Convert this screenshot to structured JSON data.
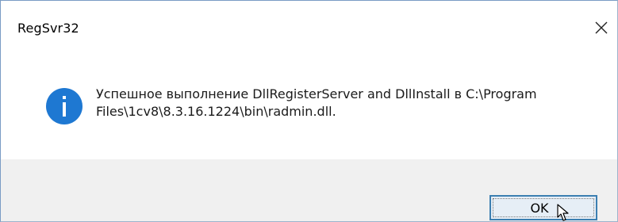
{
  "window": {
    "title": "RegSvr32"
  },
  "message": {
    "icon": "info-icon",
    "line1": "Успешное выполнение DllRegisterServer and DllInstall в C:\\Program",
    "line2": "Files\\1cv8\\8.3.16.1224\\bin\\radmin.dll."
  },
  "buttons": {
    "ok_label": "OK"
  },
  "colors": {
    "info_icon": "#1e78d2",
    "ok_border": "#3c7fb1",
    "footer_bg": "#f0f0f0"
  }
}
